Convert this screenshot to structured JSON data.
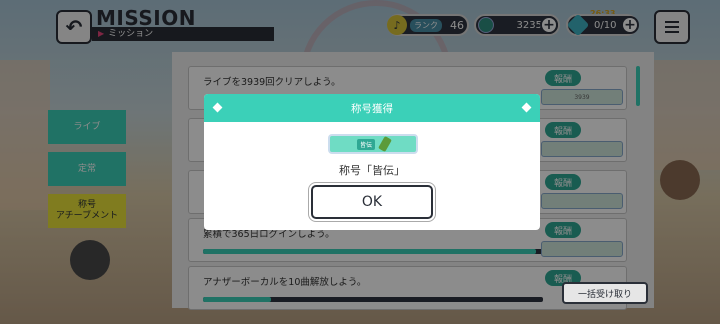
{
  "header": {
    "title": "MISSION",
    "subtitle": "ミッション",
    "back_icon": "back-arrow-icon",
    "menu_icon": "hamburger-menu-icon"
  },
  "status": {
    "rank_label": "ランク",
    "rank_value": "46",
    "coins_value": "3235",
    "stamina_value": "0/10",
    "stamina_timer": "26:33"
  },
  "sidebar": {
    "tabs": [
      {
        "label": "ライブ",
        "active": false
      },
      {
        "label": "定常",
        "active": false
      },
      {
        "label": "称号\nアチーブメント",
        "active": true
      }
    ]
  },
  "missions": [
    {
      "text": "ライブを3939回クリアしよう。",
      "reward_label": "報酬",
      "reward_item": "3939",
      "progress": 0.0
    },
    {
      "text": "",
      "reward_label": "報酬",
      "reward_item": "",
      "progress": 0.0
    },
    {
      "text": "",
      "reward_label": "報酬",
      "reward_item": "",
      "progress": 0.0
    },
    {
      "text": "累積で365日ログインしよう。",
      "reward_label": "報酬",
      "reward_item": "",
      "progress": 0.98
    },
    {
      "text": "アナザーボーカルを10曲解放しよう。",
      "reward_label": "報酬",
      "reward_item": "",
      "progress": 0.2
    }
  ],
  "collect_all_label": "一括受け取り",
  "modal": {
    "title": "称号獲得",
    "badge_tag": "皆伝",
    "message": "称号「皆伝」",
    "ok_label": "OK"
  }
}
